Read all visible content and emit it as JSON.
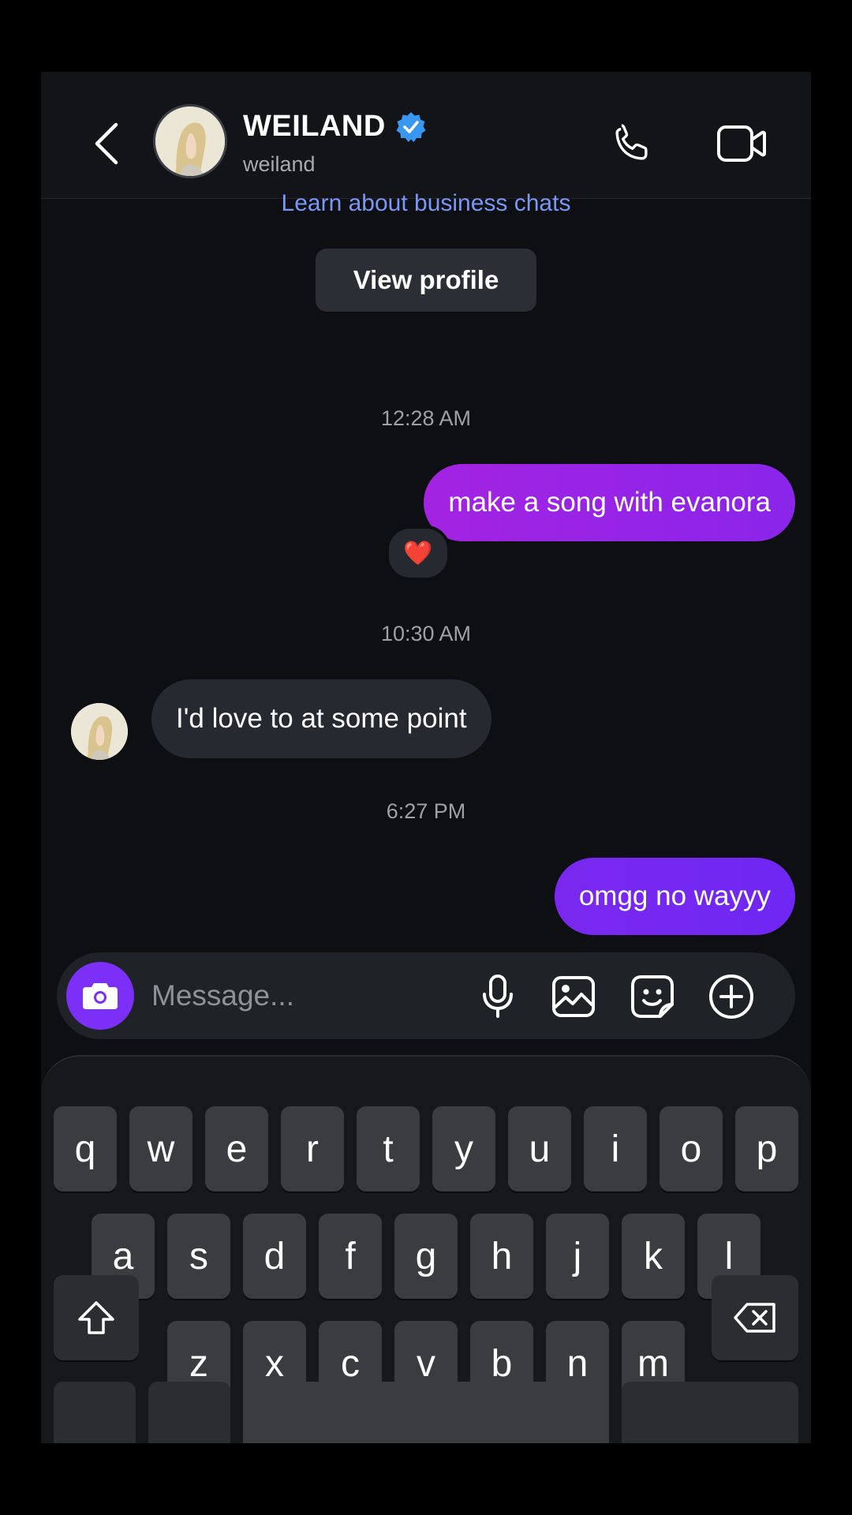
{
  "header": {
    "name": "WEILAND",
    "username": "weiland",
    "verified": true
  },
  "chat": {
    "learn_link": "Learn about business chats",
    "view_profile_label": "View profile",
    "messages": [
      {
        "type": "timestamp",
        "text": "12:28 AM"
      },
      {
        "type": "outgoing",
        "text": "make a song with evanora",
        "reaction": "❤️"
      },
      {
        "type": "timestamp",
        "text": "10:30 AM"
      },
      {
        "type": "incoming",
        "text": "I'd love to at some point"
      },
      {
        "type": "timestamp",
        "text": "6:27 PM"
      },
      {
        "type": "outgoing",
        "text": "omgg no wayyy"
      }
    ]
  },
  "composer": {
    "placeholder": "Message..."
  },
  "keyboard": {
    "row1": [
      "q",
      "w",
      "e",
      "r",
      "t",
      "y",
      "u",
      "i",
      "o",
      "p"
    ],
    "row2": [
      "a",
      "s",
      "d",
      "f",
      "g",
      "h",
      "j",
      "k",
      "l"
    ],
    "row3": [
      "z",
      "x",
      "c",
      "v",
      "b",
      "n",
      "m"
    ]
  },
  "colors": {
    "outgoing_bubble_start": "#a423e2",
    "outgoing_bubble_end": "#6f27f3",
    "link": "#7b97f5",
    "verified": "#3897f0",
    "camera_button": "#7b2ff7"
  }
}
